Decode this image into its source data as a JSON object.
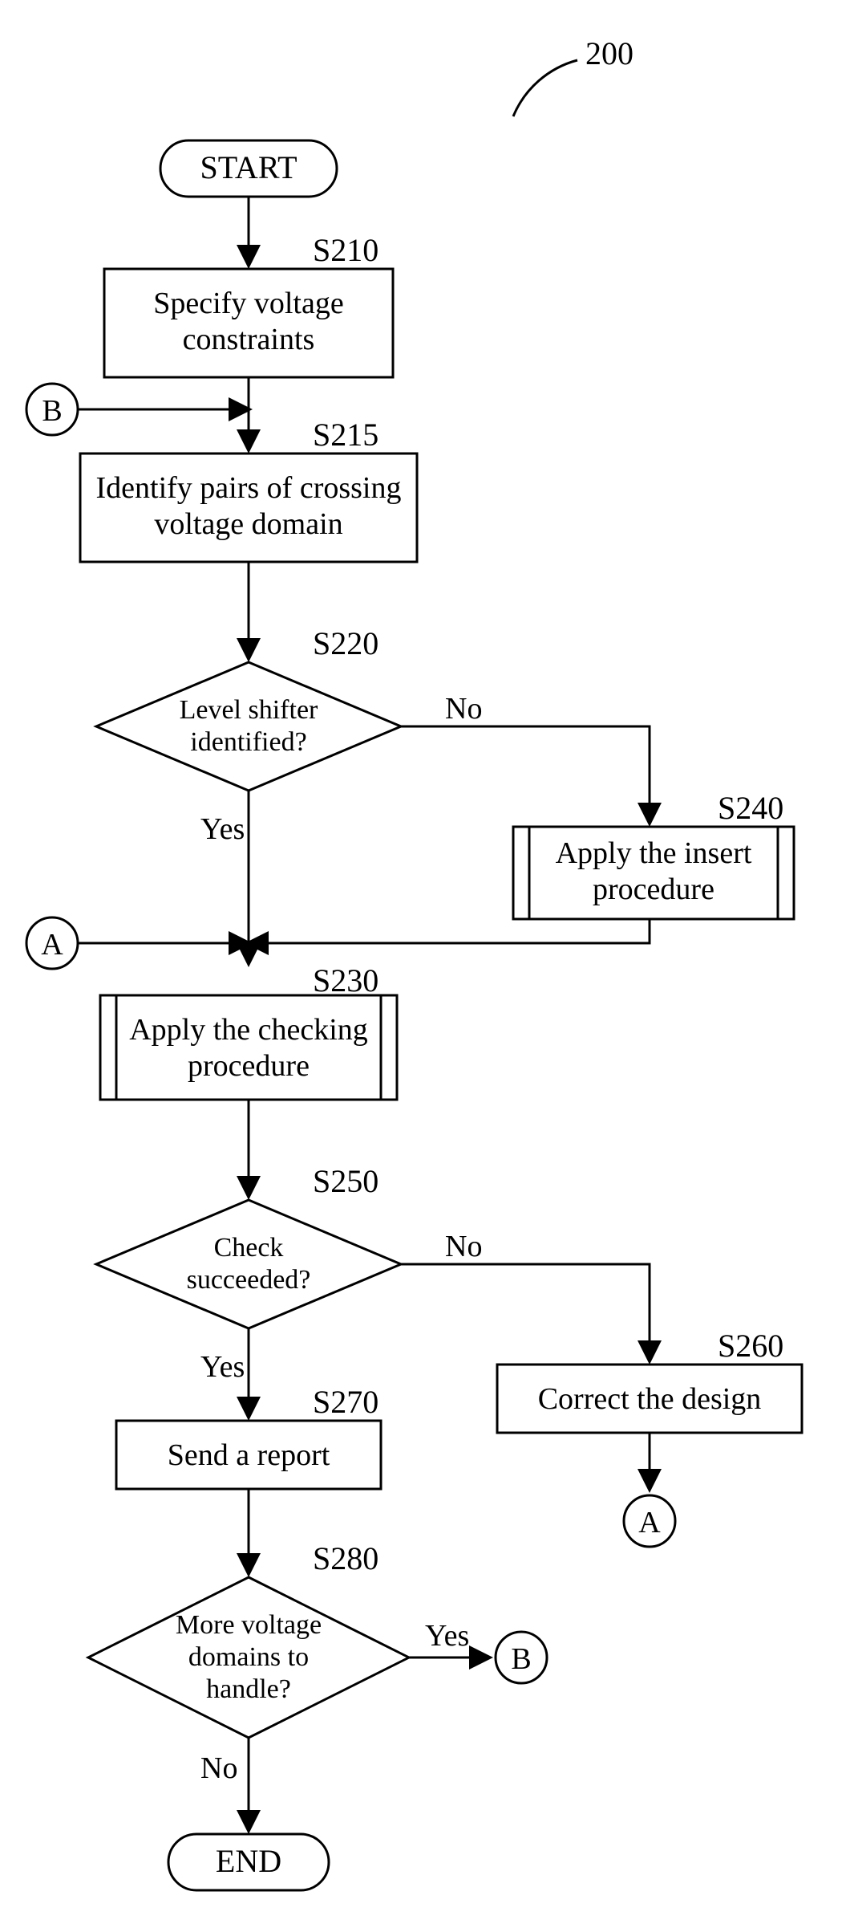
{
  "figure_ref": "200",
  "terminator": {
    "start": "START",
    "end": "END"
  },
  "steps": {
    "s210": {
      "id": "S210",
      "text_l1": "Specify voltage",
      "text_l2": "constraints"
    },
    "s215": {
      "id": "S215",
      "text_l1": "Identify pairs of crossing",
      "text_l2": "voltage domain"
    },
    "s220": {
      "id": "S220",
      "text_l1": "Level shifter",
      "text_l2": "identified?"
    },
    "s230": {
      "id": "S230",
      "text_l1": "Apply the checking",
      "text_l2": "procedure"
    },
    "s240": {
      "id": "S240",
      "text_l1": "Apply the insert",
      "text_l2": "procedure"
    },
    "s250": {
      "id": "S250",
      "text_l1": "Check",
      "text_l2": "succeeded?"
    },
    "s260": {
      "id": "S260",
      "text": "Correct the design"
    },
    "s270": {
      "id": "S270",
      "text": "Send a report"
    },
    "s280": {
      "id": "S280",
      "text_l1": "More voltage",
      "text_l2": "domains to",
      "text_l3": "handle?"
    }
  },
  "labels": {
    "yes": "Yes",
    "no": "No"
  },
  "connectors": {
    "a": "A",
    "b": "B"
  }
}
